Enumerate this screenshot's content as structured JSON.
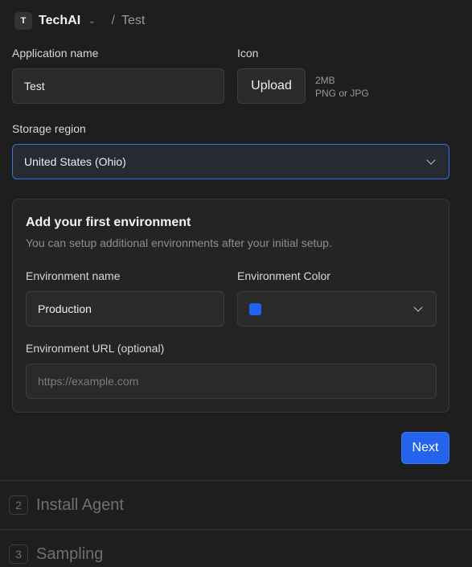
{
  "breadcrumb": {
    "org_initial": "T",
    "org_name": "TechAI",
    "separator": "/",
    "page": "Test"
  },
  "app_form": {
    "name_label": "Application name",
    "name_value": "Test",
    "icon_label": "Icon",
    "upload_button": "Upload",
    "upload_hint_size": "2MB",
    "upload_hint_types": "PNG or JPG",
    "region_label": "Storage region",
    "region_value": "United States (Ohio)"
  },
  "environment": {
    "title": "Add your first environment",
    "subtitle": "You can setup additional environments after your initial setup.",
    "name_label": "Environment name",
    "name_value": "Production",
    "color_label": "Environment Color",
    "color_value": "#1f63f5",
    "url_label": "Environment URL (optional)",
    "url_placeholder": "https://example.com"
  },
  "actions": {
    "next_button": "Next"
  },
  "steps": [
    {
      "number": "2",
      "label": "Install Agent"
    },
    {
      "number": "3",
      "label": "Sampling"
    }
  ],
  "colors": {
    "accent": "#2463eb",
    "focus_border": "#3b6fd8",
    "background": "#1e1e1e"
  }
}
